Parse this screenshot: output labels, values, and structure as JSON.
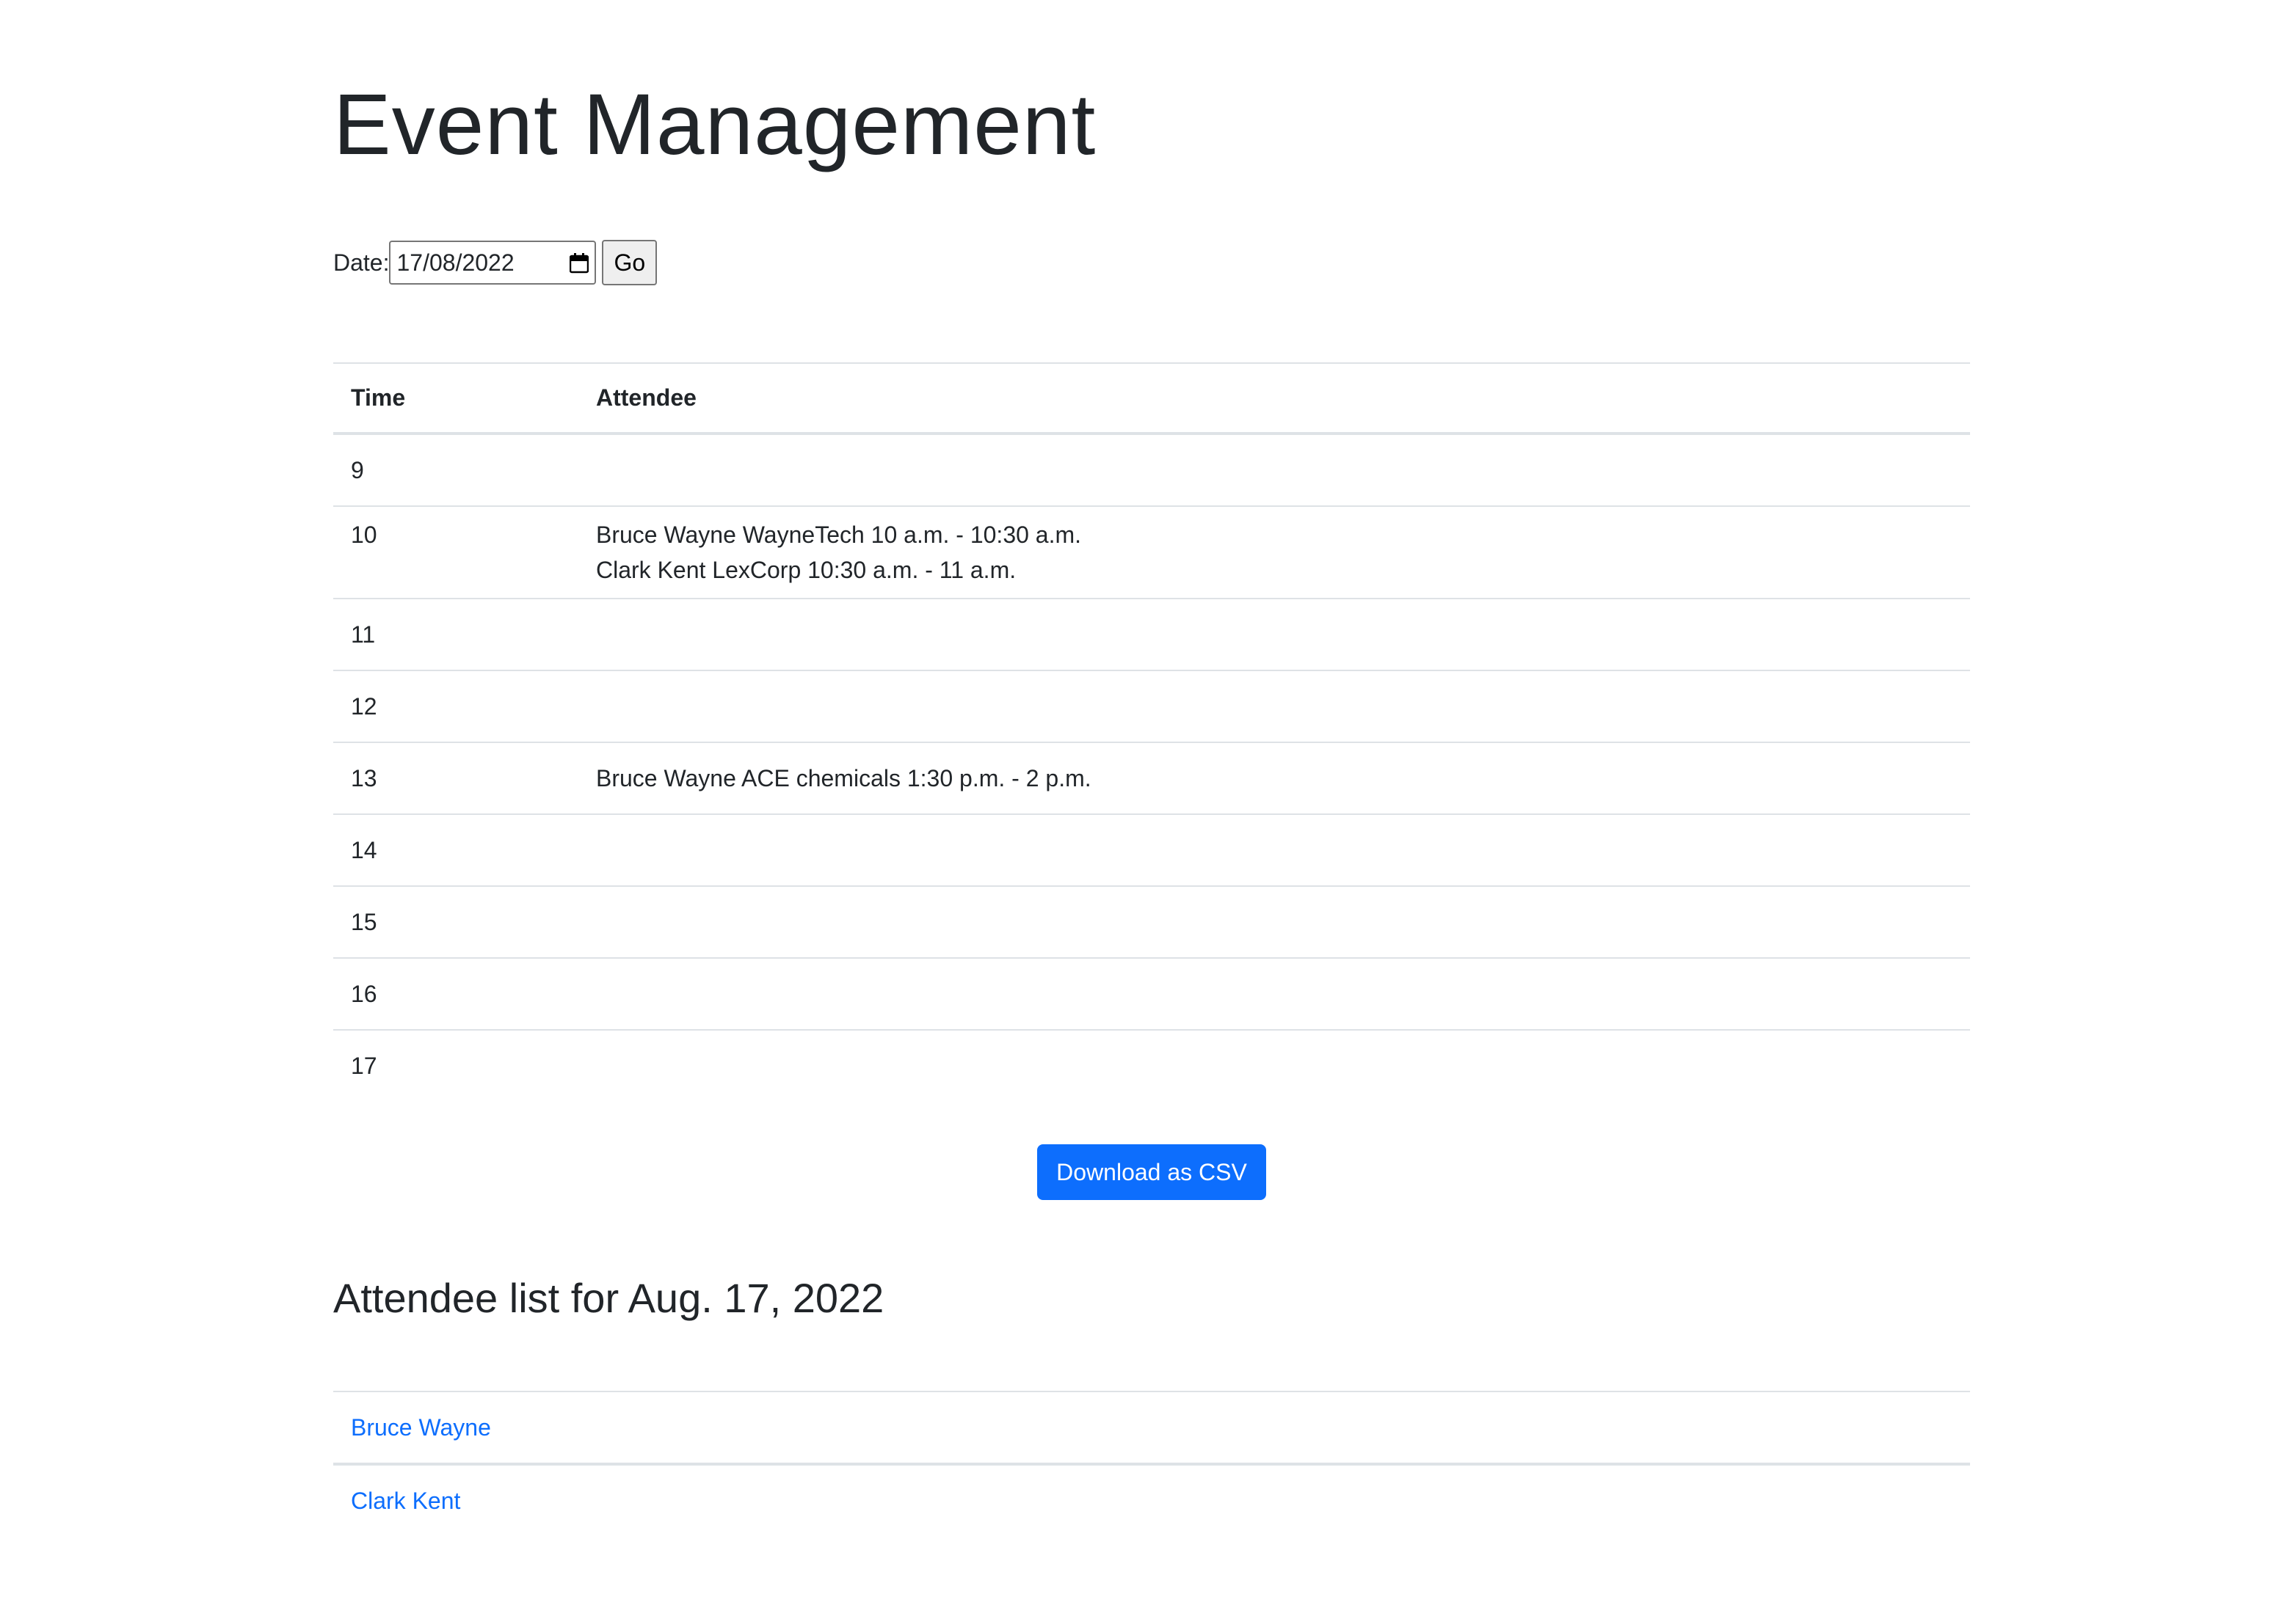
{
  "header": {
    "title": "Event Management"
  },
  "date_form": {
    "label": "Date:",
    "value": "17/08/2022",
    "go_label": "Go"
  },
  "schedule": {
    "columns": [
      "Time",
      "Attendee"
    ],
    "rows": [
      {
        "time": "9",
        "events": []
      },
      {
        "time": "10",
        "events": [
          "Bruce Wayne WayneTech 10 a.m. - 10:30 a.m.",
          "Clark Kent LexCorp 10:30 a.m. - 11 a.m."
        ]
      },
      {
        "time": "11",
        "events": []
      },
      {
        "time": "12",
        "events": []
      },
      {
        "time": "13",
        "events": [
          "Bruce Wayne ACE chemicals 1:30 p.m. - 2 p.m."
        ]
      },
      {
        "time": "14",
        "events": []
      },
      {
        "time": "15",
        "events": []
      },
      {
        "time": "16",
        "events": []
      },
      {
        "time": "17",
        "events": []
      }
    ]
  },
  "csv_button": {
    "label": "Download as CSV"
  },
  "attendee_section": {
    "heading": "Attendee list for Aug. 17, 2022",
    "attendees": [
      "Bruce Wayne",
      "Clark Kent"
    ]
  },
  "colors": {
    "accent": "#0d6efd",
    "text": "#212529",
    "border": "#dee2e6"
  }
}
